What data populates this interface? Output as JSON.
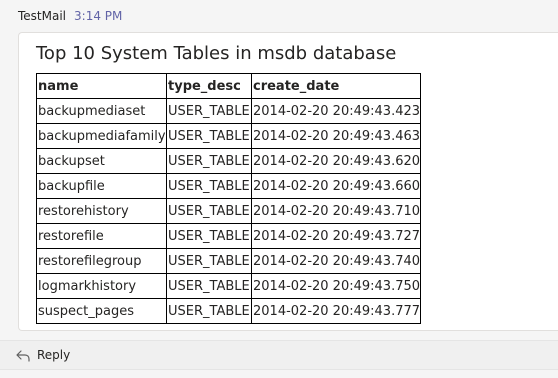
{
  "message": {
    "sender": "TestMail",
    "time": "3:14 PM"
  },
  "card": {
    "title": "Top 10 System Tables in msdb database",
    "table": {
      "headers": [
        "name",
        "type_desc",
        "create_date"
      ],
      "rows": [
        [
          "backupmediaset",
          "USER_TABLE",
          "2014-02-20 20:49:43.423"
        ],
        [
          "backupmediafamily",
          "USER_TABLE",
          "2014-02-20 20:49:43.463"
        ],
        [
          "backupset",
          "USER_TABLE",
          "2014-02-20 20:49:43.620"
        ],
        [
          "backupfile",
          "USER_TABLE",
          "2014-02-20 20:49:43.660"
        ],
        [
          "restorehistory",
          "USER_TABLE",
          "2014-02-20 20:49:43.710"
        ],
        [
          "restorefile",
          "USER_TABLE",
          "2014-02-20 20:49:43.727"
        ],
        [
          "restorefilegroup",
          "USER_TABLE",
          "2014-02-20 20:49:43.740"
        ],
        [
          "logmarkhistory",
          "USER_TABLE",
          "2014-02-20 20:49:43.750"
        ],
        [
          "suspect_pages",
          "USER_TABLE",
          "2014-02-20 20:49:43.777"
        ]
      ]
    }
  },
  "reply": {
    "label": "Reply",
    "icon": "reply-icon"
  },
  "colors": {
    "time_accent": "#6264a7",
    "text": "#252423",
    "background": "#f5f5f5"
  }
}
